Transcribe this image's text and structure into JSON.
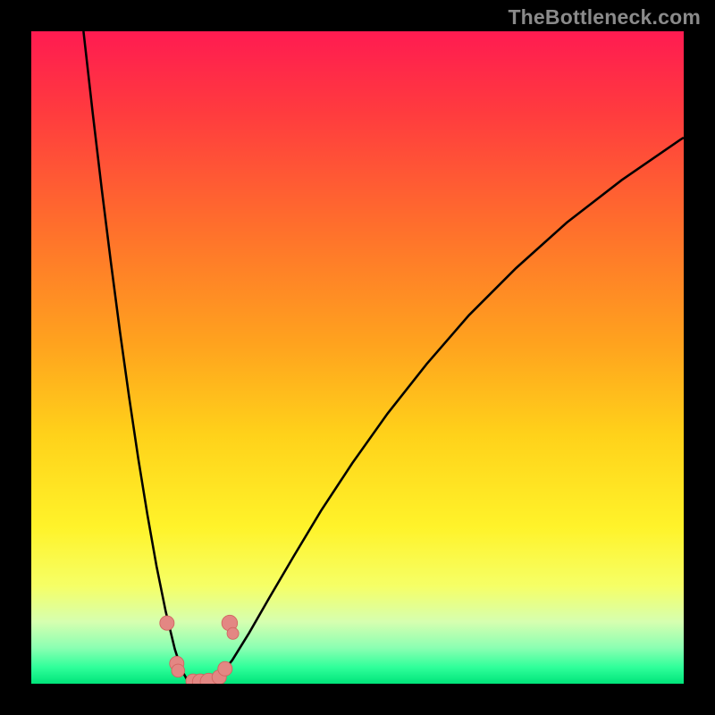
{
  "watermark": "TheBottleneck.com",
  "colors": {
    "frame": "#000000",
    "gradient_stops": [
      {
        "offset": 0.0,
        "color": "#ff1b51"
      },
      {
        "offset": 0.12,
        "color": "#ff3a3f"
      },
      {
        "offset": 0.3,
        "color": "#ff6f2c"
      },
      {
        "offset": 0.48,
        "color": "#ffa31e"
      },
      {
        "offset": 0.62,
        "color": "#ffd21a"
      },
      {
        "offset": 0.76,
        "color": "#fff32a"
      },
      {
        "offset": 0.85,
        "color": "#f6ff66"
      },
      {
        "offset": 0.905,
        "color": "#d6ffb0"
      },
      {
        "offset": 0.945,
        "color": "#8bffb2"
      },
      {
        "offset": 0.975,
        "color": "#2fff9a"
      },
      {
        "offset": 1.0,
        "color": "#00e47a"
      }
    ],
    "curve": "#000000",
    "marker_fill": "#e38783",
    "marker_stroke": "#d06560"
  },
  "chart_data": {
    "type": "line",
    "title": "",
    "xlabel": "",
    "ylabel": "",
    "xlim": [
      0,
      100
    ],
    "ylim": [
      0,
      100
    ],
    "grid": false,
    "series": [
      {
        "name": "left-branch",
        "x": [
          8.0,
          9.4,
          10.8,
          12.2,
          13.6,
          15.0,
          16.4,
          17.8,
          19.2,
          20.6,
          22.0,
          23.0,
          24.0,
          25.0,
          26.0,
          27.0
        ],
        "y": [
          100.0,
          87.6,
          75.8,
          64.6,
          53.9,
          43.9,
          34.5,
          25.9,
          18.0,
          11.1,
          5.3,
          2.2,
          0.4,
          0.0,
          0.0,
          0.0
        ]
      },
      {
        "name": "right-branch",
        "x": [
          27.0,
          28.7,
          30.8,
          33.4,
          36.5,
          40.2,
          44.4,
          49.2,
          54.6,
          60.6,
          67.1,
          74.3,
          82.1,
          90.5,
          99.5,
          100.0
        ],
        "y": [
          0.0,
          1.0,
          3.6,
          7.8,
          13.2,
          19.5,
          26.5,
          33.8,
          41.4,
          49.0,
          56.5,
          63.7,
          70.7,
          77.2,
          83.4,
          83.7
        ]
      }
    ],
    "markers": [
      {
        "x": 20.8,
        "y": 9.3,
        "r": 1.1
      },
      {
        "x": 22.3,
        "y": 3.1,
        "r": 1.1
      },
      {
        "x": 22.5,
        "y": 2.0,
        "r": 1.0
      },
      {
        "x": 24.8,
        "y": 0.4,
        "r": 1.1
      },
      {
        "x": 25.9,
        "y": 0.3,
        "r": 1.2
      },
      {
        "x": 27.2,
        "y": 0.3,
        "r": 1.3
      },
      {
        "x": 28.8,
        "y": 1.0,
        "r": 1.1
      },
      {
        "x": 29.7,
        "y": 2.3,
        "r": 1.1
      },
      {
        "x": 30.4,
        "y": 9.3,
        "r": 1.2
      },
      {
        "x": 30.9,
        "y": 7.7,
        "r": 0.9
      }
    ]
  }
}
